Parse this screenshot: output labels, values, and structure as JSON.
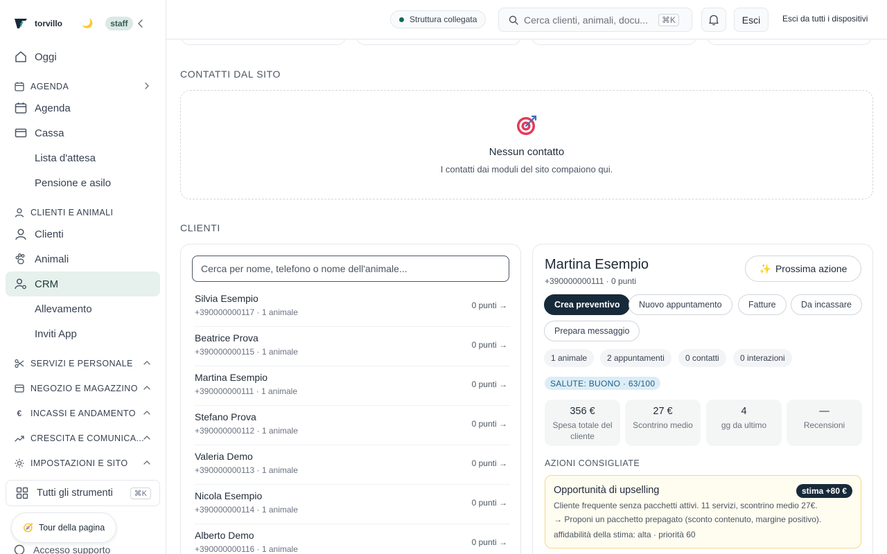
{
  "brand": {
    "name": "torvillo",
    "role_badge": "staff"
  },
  "sidebar": {
    "today": "Oggi",
    "sections": {
      "agenda": "AGENDA",
      "clients_animals": "CLIENTI E ANIMALI",
      "services_staff": "SERVIZI E PERSONALE",
      "shop_stock": "NEGOZIO E MAGAZZINO",
      "revenue": "INCASSI E ANDAMENTO",
      "growth": "CRESCITA E COMUNICA...",
      "settings": "IMPOSTAZIONI E SITO"
    },
    "items": {
      "agenda": "Agenda",
      "cash": "Cassa",
      "waitlist": "Lista d'attesa",
      "boarding": "Pensione e asilo",
      "clients": "Clienti",
      "animals": "Animali",
      "crm": "CRM",
      "breeding": "Allevamento",
      "app_invites": "Inviti App"
    },
    "all_tools": "Tutti gli strumenti",
    "all_tools_kbd": "⌘K",
    "tour": "Tour della pagina",
    "support": "Accesso supporto"
  },
  "topbar": {
    "status": "Struttura collegata",
    "search_placeholder": "Cerca clienti, animali, docu...",
    "search_kbd": "⌘K",
    "exit": "Esci",
    "exit_all": "Esci da tutti i dispositivi"
  },
  "site_contacts": {
    "title": "CONTATTI DAL SITO",
    "empty_title": "Nessun contatto",
    "empty_sub": "I contatti dai moduli del sito compaiono qui."
  },
  "clients": {
    "title": "CLIENTI",
    "search_placeholder": "Cerca per nome, telefono o nome dell'animale...",
    "rows": [
      {
        "name": "Silvia Esempio",
        "meta": "+390000000117 · 1 animale",
        "points": "0 punti →"
      },
      {
        "name": "Beatrice Prova",
        "meta": "+390000000115 · 1 animale",
        "points": "0 punti →"
      },
      {
        "name": "Martina Esempio",
        "meta": "+390000000111 · 1 animale",
        "points": "0 punti →"
      },
      {
        "name": "Stefano Prova",
        "meta": "+390000000112 · 1 animale",
        "points": "0 punti →"
      },
      {
        "name": "Valeria Demo",
        "meta": "+390000000113 · 1 animale",
        "points": "0 punti →"
      },
      {
        "name": "Nicola Esempio",
        "meta": "+390000000114 · 1 animale",
        "points": "0 punti →"
      },
      {
        "name": "Alberto Demo",
        "meta": "+390000000116 · 1 animale",
        "points": "0 punti →"
      }
    ]
  },
  "detail": {
    "name": "Martina Esempio",
    "meta": "+390000000111 · 0 punti",
    "next_action": "Prossima azione",
    "actions": {
      "quote": "Crea preventivo",
      "new_appointment": "Nuovo appuntamento",
      "invoices": "Fatture",
      "to_collect": "Da incassare",
      "prepare_message": "Prepara messaggio"
    },
    "stats": {
      "animals": "1 animale",
      "appointments": "2 appuntamenti",
      "contacts": "0 contatti",
      "interactions": "0 interazioni"
    },
    "health": "SALUTE: BUONO · 63/100",
    "kpis": [
      {
        "value": "356 €",
        "label": "Spesa totale del cliente"
      },
      {
        "value": "27 €",
        "label": "Scontrino medio"
      },
      {
        "value": "4",
        "label": "gg da ultimo"
      },
      {
        "value": "—",
        "label": "Recensioni"
      }
    ],
    "recommended_title": "AZIONI CONSIGLIATE",
    "recommendation": {
      "title": "Opportunità di upselling",
      "badge": "stima +80 €",
      "line1": "Cliente frequente senza pacchetti attivi. 11 servizi, scontrino medio 27€.",
      "line2": "→ Proponi un pacchetto prepagato (sconto contenuto, margine positivo).",
      "line3": "affidabilità della stima: alta   ·   priorità 60"
    }
  },
  "colors": {
    "accent": "#172a3a",
    "active_bg": "#e6f0ec",
    "status_dot": "#0f6b55"
  }
}
